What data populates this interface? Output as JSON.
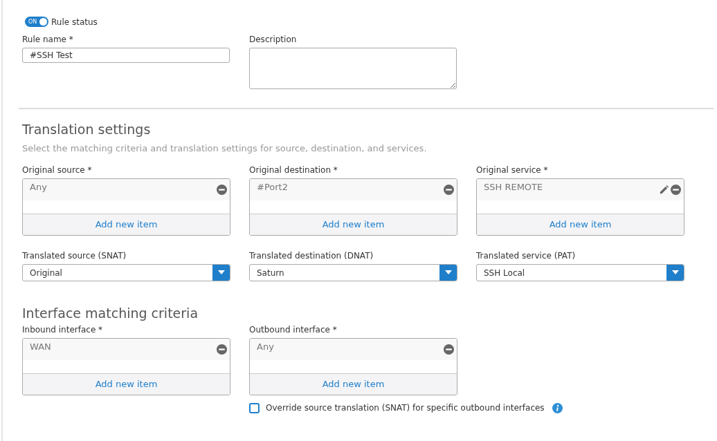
{
  "rule_status": {
    "toggle_text": "ON",
    "on": true,
    "label": "Rule status"
  },
  "rule_name": {
    "label": "Rule name *",
    "value": "#SSH Test"
  },
  "description": {
    "label": "Description"
  },
  "translation": {
    "title": "Translation settings",
    "subtitle": "Select the matching criteria and translation settings for source, destination, and services.",
    "original": [
      {
        "label": "Original source *",
        "items": [
          {
            "text": "Any",
            "editable": false
          }
        ],
        "add_label": "Add new item"
      },
      {
        "label": "Original destination *",
        "items": [
          {
            "text": "#Port2",
            "editable": false
          }
        ],
        "add_label": "Add new item"
      },
      {
        "label": "Original service *",
        "items": [
          {
            "text": "SSH REMOTE",
            "editable": true
          }
        ],
        "add_label": "Add new item"
      }
    ],
    "translated": [
      {
        "label": "Translated source (SNAT)",
        "value": "Original"
      },
      {
        "label": "Translated destination (DNAT)",
        "value": "Saturn"
      },
      {
        "label": "Translated service (PAT)",
        "value": "SSH Local"
      }
    ]
  },
  "interface": {
    "title": "Interface matching criteria",
    "boxes": [
      {
        "label": "Inbound interface *",
        "items": [
          {
            "text": "WAN",
            "editable": false
          }
        ],
        "add_label": "Add new item"
      },
      {
        "label": "Outbound interface *",
        "items": [
          {
            "text": "Any",
            "editable": false
          }
        ],
        "add_label": "Add new item"
      }
    ],
    "override": {
      "label": "Override source translation (SNAT) for specific outbound interfaces",
      "checked": false
    }
  }
}
